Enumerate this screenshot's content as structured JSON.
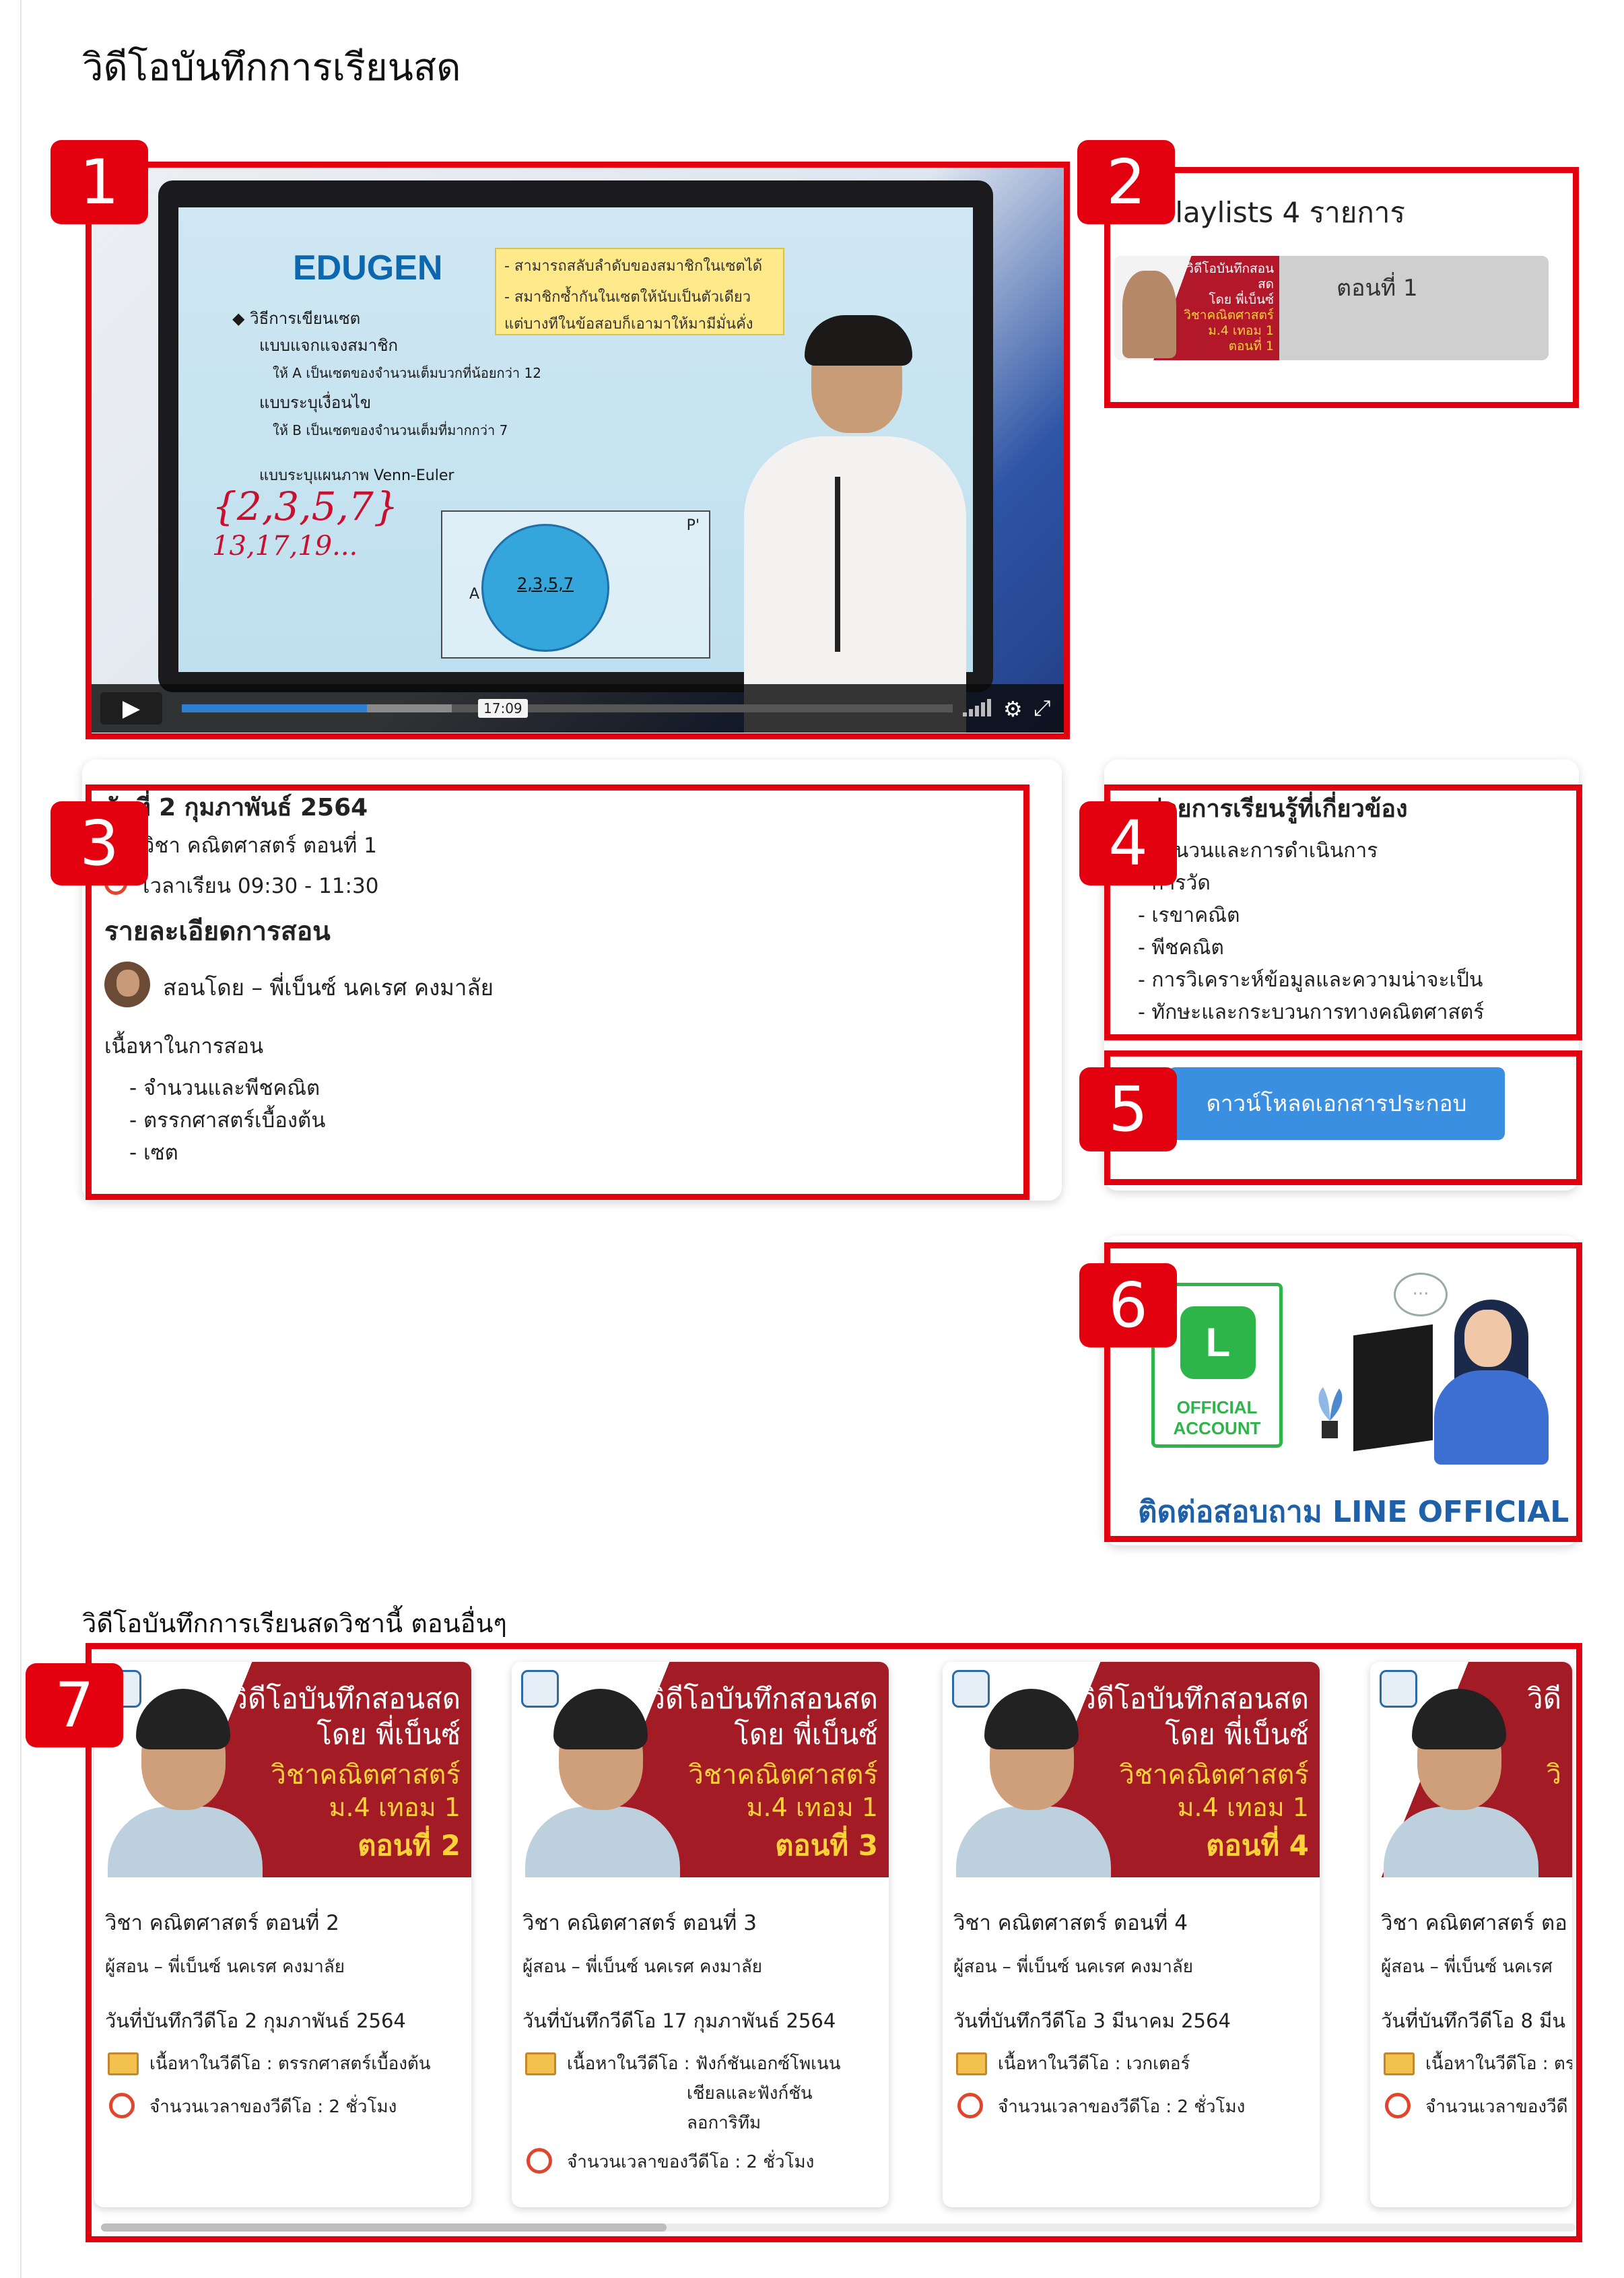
{
  "page": {
    "title": "วิดีโอบันทึกการเรียนสด"
  },
  "annotations": [
    "1",
    "2",
    "3",
    "4",
    "5",
    "6",
    "7"
  ],
  "video": {
    "current_time_tooltip": "17:09",
    "progress_fraction": 0.24,
    "buffered_fraction": 0.35,
    "slide": {
      "logo": "EDUGEN",
      "lines": [
        "◆ วิธีการเขียนเซต",
        "แบบแจกแจงสมาชิก",
        "ให้ A เป็นเซตของจำนวนเต็มบวกที่น้อยกว่า 12",
        "แบบระบุเงื่อนไข",
        "ให้ B เป็นเซตของจำนวนเต็มที่มากกว่า 7",
        "แบบระบุแผนภาพ Venn-Euler"
      ],
      "box_lines": [
        "- สามารถสลับลำดับของสมาชิกในเซตได้",
        "- สมาชิกซ้ำกันในเซตให้นับเป็นตัวเดียว",
        "แต่บางทีในข้อสอบก็เอามาให้มามีมั่นคั่ง"
      ],
      "venn_label": "2,3,5,7",
      "venn_set": "A",
      "venn_universe": "P'"
    }
  },
  "playlist": {
    "title": "Playlists 4 รายการ",
    "items": [
      {
        "label": "ตอนที่ 1",
        "thumb_lines": [
          "วิดีโอบันทึกสอนสด",
          "โดย พี่เบ็นซ์",
          "วิชาคณิตศาสตร์",
          "ม.4 เทอม 1",
          "ตอนที่ 1"
        ]
      }
    ]
  },
  "lesson": {
    "date": "วันที่ 2 กุมภาพันธ์ 2564",
    "subject": "วิชา คณิตศาสตร์ ตอนที่ 1",
    "time": "เวลาเรียน 09:30 - 11:30",
    "details_heading": "รายละเอียดการสอน",
    "teacher": "สอนโดย – พี่เบ็นซ์ นคเรศ คงมาลัย",
    "content_heading": "เนื้อหาในการสอน",
    "content_items": [
      "- จำนวนและพีชคณิต",
      "- ตรรกศาสตร์เบื้องต้น",
      "- เซต"
    ]
  },
  "related_units": {
    "heading": "หน่วยการเรียนรู้ที่เกี่ยวข้อง",
    "items": [
      "- จำนวนและการดำเนินการ",
      "- การวัด",
      "- เรขาคณิต",
      "- พีชคณิต",
      "- การวิเคราะห์ข้อมูลและความน่าจะเป็น",
      "- ทักษะและกระบวนการทางคณิตศาสตร์"
    ]
  },
  "download": {
    "label": "ดาวน์โหลดเอกสารประกอบ"
  },
  "line_banner": {
    "logo_text": "L",
    "oa_line1": "OFFICIAL",
    "oa_line2": "ACCOUNT",
    "title": "ติดต่อสอบถาม LINE OFFICIAL",
    "chat_dots": "···"
  },
  "related_videos": {
    "heading": "วิดีโอบันทึกการเรียนสดวิชานี้ ตอนอื่นๆ",
    "cards": [
      {
        "thumb": [
          "วิดีโอบันทึกสอนสด",
          "โดย พี่เบ็นซ์",
          "วิชาคณิตศาสตร์",
          "ม.4 เทอม 1",
          "ตอนที่ 2"
        ],
        "title": "วิชา คณิตศาสตร์ ตอนที่ 2",
        "teacher": "ผู้สอน – พี่เบ็นซ์ นคเรศ คงมาลัย",
        "date": "วันที่บันทึกวีดีโอ 2 กุมภาพันธ์ 2564",
        "content": "เนื้อหาในวีดีโอ : ตรรกศาสตร์เบื้องต้น",
        "duration": "จำนวนเวลาของวีดีโอ : 2 ชั่วโมง"
      },
      {
        "thumb": [
          "วิดีโอบันทึกสอนสด",
          "โดย พี่เบ็นซ์",
          "วิชาคณิตศาสตร์",
          "ม.4 เทอม 1",
          "ตอนที่ 3"
        ],
        "title": "วิชา คณิตศาสตร์ ตอนที่ 3",
        "teacher": "ผู้สอน – พี่เบ็นซ์ นคเรศ คงมาลัย",
        "date": "วันที่บันทึกวีดีโอ 17 กุมภาพันธ์ 2564",
        "content": "เนื้อหาในวีดีโอ : ฟังก์ชันเอกซ์โพเนน",
        "content_line2": "เชียลและฟังก์ชัน",
        "content_line3": "ลอการิทึม",
        "duration": "จำนวนเวลาของวีดีโอ : 2 ชั่วโมง"
      },
      {
        "thumb": [
          "วิดีโอบันทึกสอนสด",
          "โดย พี่เบ็นซ์",
          "วิชาคณิตศาสตร์",
          "ม.4 เทอม 1",
          "ตอนที่ 4"
        ],
        "title": "วิชา คณิตศาสตร์ ตอนที่ 4",
        "teacher": "ผู้สอน – พี่เบ็นซ์ นคเรศ คงมาลัย",
        "date": "วันที่บันทึกวีดีโอ 3 มีนาคม 2564",
        "content": "เนื้อหาในวีดีโอ : เวกเตอร์",
        "duration": "จำนวนเวลาของวีดีโอ : 2 ชั่วโมง"
      },
      {
        "thumb": [
          "วิดี",
          "",
          "วิ",
          "",
          ""
        ],
        "title": "วิชา คณิตศาสตร์ ตอ",
        "teacher": "ผู้สอน – พี่เบ็นซ์ นคเรศ",
        "date": "วันที่บันทึกวีดีโอ 8 มีน",
        "content": "เนื้อหาในวีดีโอ : ตร",
        "duration": "จำนวนเวลาของวีดี"
      }
    ]
  }
}
